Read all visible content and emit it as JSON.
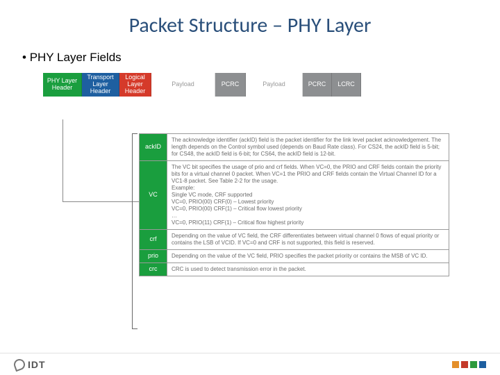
{
  "title": "Packet Structure – PHY Layer",
  "subtitle": "PHY Layer Fields",
  "packet": {
    "phy": "PHY Layer Header",
    "trans": "Transport Layer Header",
    "logic": "Logical Layer Header",
    "pay1": "Payload",
    "pcrc1": "PCRC",
    "pay2": "Payload",
    "pcrc2": "PCRC",
    "lcrc": "LCRC"
  },
  "fields": {
    "ackid": {
      "name": "ackID",
      "desc": "The acknowledge identifier (ackID) field is the packet identifier for the link level packet acknowledgement. The length depends on the Control symbol used (depends on Baud Rate class). For CS24, the ackID field is 5-bit; for CS48, the ackID field is 6-bit; for CS64, the ackID field is 12-bit."
    },
    "vc": {
      "name": "VC",
      "desc": "The VC bit specifies the usage of prio and crf fields. When VC=0, the PRIO and CRF fields contain the priority bits for a virtual channel 0 packet. When VC=1 the PRIO and CRF fields contain the Virtual Channel ID for a VC1-8 packet. See Table 2-2 for the usage.\nExample:\nSingle VC mode, CRF supported\nVC=0, PRIO(00) CRF(0) – Lowest priority\nVC=0, PRIO(00) CRF(1) – Critical flow lowest priority\n…\nVC=0, PRIO(11) CRF(1) – Critical flow highest priority"
    },
    "crf": {
      "name": "crf",
      "desc": "Depending on the value of VC field, the CRF differentiates between virtual channel 0 flows of equal priority or contains the LSB of VCID. If VC=0 and CRF is not supported, this field is reserved."
    },
    "prio": {
      "name": "prio",
      "desc": "Depending on the value of the VC field, PRIO specifies the packet priority or contains the MSB of VC ID."
    },
    "crc": {
      "name": "crc",
      "desc": "CRC is used to detect transmission error in the packet."
    }
  },
  "logo_text": "IDT"
}
